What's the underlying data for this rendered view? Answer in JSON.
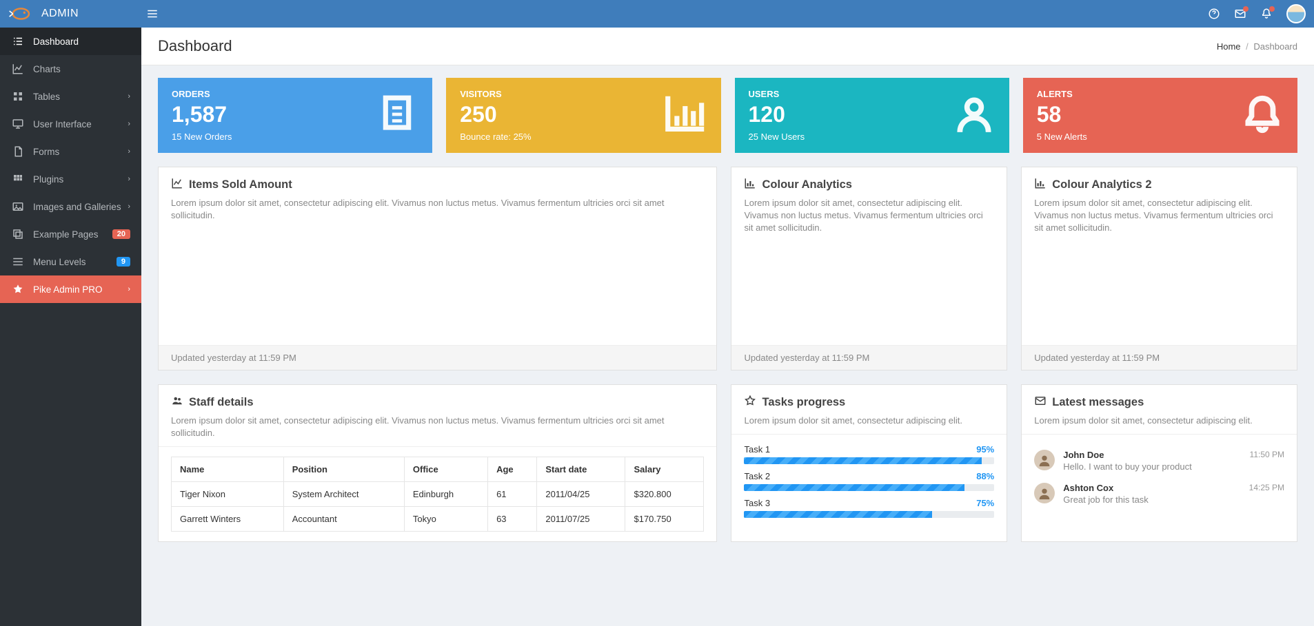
{
  "brand": {
    "name": "ADMIN"
  },
  "sidebar": {
    "items": [
      {
        "label": "Dashboard",
        "icon": "list",
        "active": true
      },
      {
        "label": "Charts",
        "icon": "chart-line",
        "chevron": false
      },
      {
        "label": "Tables",
        "icon": "grid",
        "chevron": true
      },
      {
        "label": "User Interface",
        "icon": "monitor",
        "chevron": true
      },
      {
        "label": "Forms",
        "icon": "file",
        "chevron": true
      },
      {
        "label": "Plugins",
        "icon": "modules",
        "chevron": true
      },
      {
        "label": "Images and Galleries",
        "icon": "image",
        "chevron": true
      },
      {
        "label": "Example Pages",
        "icon": "copy",
        "badge": "20",
        "badge_class": "badge-red"
      },
      {
        "label": "Menu Levels",
        "icon": "menu",
        "badge": "9",
        "badge_class": "badge-blue"
      },
      {
        "label": "Pike Admin PRO",
        "icon": "star",
        "chevron": true,
        "highlight": true
      }
    ]
  },
  "page": {
    "title": "Dashboard",
    "breadcrumb_home": "Home",
    "breadcrumb_sep": "/",
    "breadcrumb_current": "Dashboard"
  },
  "stats": {
    "orders": {
      "label": "ORDERS",
      "value": "1,587",
      "sub": "15 New Orders"
    },
    "visitors": {
      "label": "VISITORS",
      "value": "250",
      "sub": "Bounce rate: 25%"
    },
    "users": {
      "label": "USERS",
      "value": "120",
      "sub": "25 New Users"
    },
    "alerts": {
      "label": "ALERTS",
      "value": "58",
      "sub": "5 New Alerts"
    }
  },
  "panels": {
    "items_sold": {
      "title": "Items Sold Amount",
      "desc": "Lorem ipsum dolor sit amet, consectetur adipiscing elit. Vivamus non luctus metus. Vivamus fermentum ultricies orci sit amet sollicitudin.",
      "footer": "Updated yesterday at 11:59 PM"
    },
    "colour1": {
      "title": "Colour Analytics",
      "desc": "Lorem ipsum dolor sit amet, consectetur adipiscing elit. Vivamus non luctus metus. Vivamus fermentum ultricies orci sit amet sollicitudin.",
      "footer": "Updated yesterday at 11:59 PM"
    },
    "colour2": {
      "title": "Colour Analytics 2",
      "desc": "Lorem ipsum dolor sit amet, consectetur adipiscing elit. Vivamus non luctus metus. Vivamus fermentum ultricies orci sit amet sollicitudin.",
      "footer": "Updated yesterday at 11:59 PM"
    },
    "staff": {
      "title": "Staff details",
      "desc": "Lorem ipsum dolor sit amet, consectetur adipiscing elit. Vivamus non luctus metus. Vivamus fermentum ultricies orci sit amet sollicitudin.",
      "columns": [
        "Name",
        "Position",
        "Office",
        "Age",
        "Start date",
        "Salary"
      ],
      "rows": [
        [
          "Tiger Nixon",
          "System Architect",
          "Edinburgh",
          "61",
          "2011/04/25",
          "$320.800"
        ],
        [
          "Garrett Winters",
          "Accountant",
          "Tokyo",
          "63",
          "2011/07/25",
          "$170.750"
        ]
      ]
    },
    "tasks": {
      "title": "Tasks progress",
      "desc": "Lorem ipsum dolor sit amet, consectetur adipiscing elit.",
      "items": [
        {
          "name": "Task 1",
          "pct": "95%",
          "width": "95%"
        },
        {
          "name": "Task 2",
          "pct": "88%",
          "width": "88%"
        },
        {
          "name": "Task 3",
          "pct": "75%",
          "width": "75%"
        }
      ]
    },
    "messages": {
      "title": "Latest messages",
      "desc": "Lorem ipsum dolor sit amet, consectetur adipiscing elit.",
      "items": [
        {
          "name": "John Doe",
          "text": "Hello. I want to buy your product",
          "time": "11:50 PM"
        },
        {
          "name": "Ashton Cox",
          "text": "Great job for this task",
          "time": "14:25 PM"
        }
      ]
    }
  }
}
